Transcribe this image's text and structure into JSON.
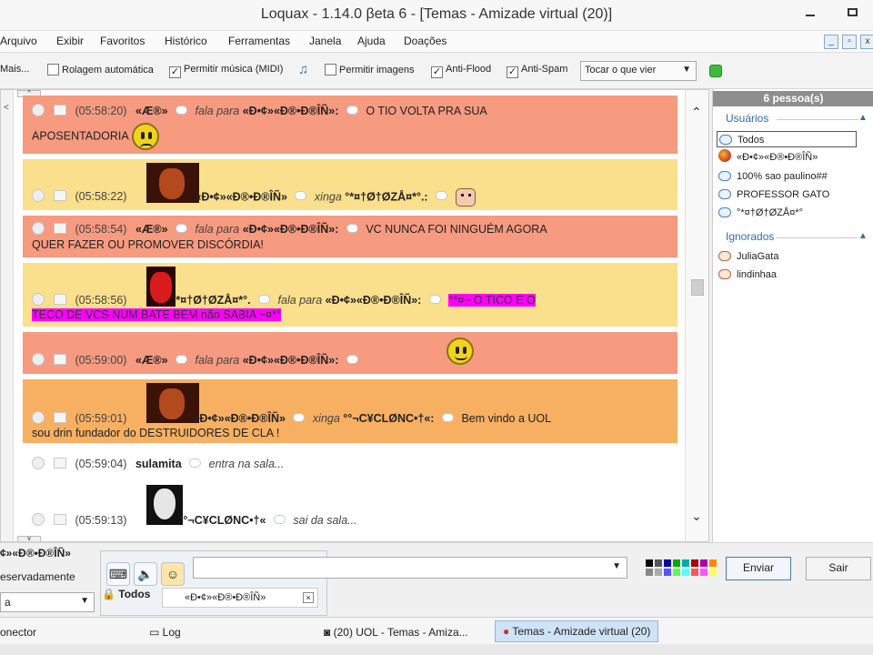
{
  "window": {
    "title": "Loquax - 1.14.0 βeta 6 - [Temas - Amizade virtual (20)]"
  },
  "menu": [
    "Arquivo",
    "Exibir",
    "Favoritos",
    "Histórico",
    "Ferramentas",
    "Janela",
    "Ajuda",
    "Doações"
  ],
  "toolbar": {
    "mais": "Mais...",
    "options": [
      {
        "label": "Rolagem automática",
        "checked": false
      },
      {
        "label": "Permitir música (MIDI)",
        "checked": true
      },
      {
        "label": "Permitir imagens",
        "checked": false
      },
      {
        "label": "Anti-Flood",
        "checked": true
      },
      {
        "label": "Anti-Spam",
        "checked": true
      }
    ],
    "sound_select": "Tocar o que vier",
    "status_color": "#3cbc3c"
  },
  "messages": [
    {
      "time": "(05:58:20)",
      "from": "«Æ®»",
      "action": "fala para",
      "to": "«Ð•¢»«Ð®•Ð®ÎÑ»:",
      "text1": "O TIO VOLTA PRA SUA",
      "text2": "APOSENTADORIA",
      "color": "#f69a80"
    },
    {
      "time": "(05:58:22)",
      "from": "«Ð•¢»«Ð®•Ð®ÎÑ»",
      "action": "xinga",
      "to": "°*¤†Ø†ØZÅ¤*°.:",
      "color": "#fadf8c"
    },
    {
      "time": "(05:58:54)",
      "from": "«Æ®»",
      "action": "fala para",
      "to": "«Ð•¢»«Ð®•Ð®ÎÑ»:",
      "text1": "VC NUNCA FOI NINGUÉM AGORA",
      "text2": "QUER FAZER OU PROMOVER DISCÓRDIA!",
      "color": "#f69a80"
    },
    {
      "time": "(05:58:56)",
      "from": "°*¤†Ø†ØZÅ¤*°.",
      "action": "fala para",
      "to": "«Ð•¢»«Ð®•Ð®ÎÑ»:",
      "text1": "°*¤~ O TICO E O",
      "text2": "TECO DE VCS NUM BATE BEM não SABIA ~¤*°",
      "color": "#fadf8c"
    },
    {
      "time": "(05:59:00)",
      "from": "«Æ®»",
      "action": "fala para",
      "to": "«Ð•¢»«Ð®•Ð®ÎÑ»:",
      "color": "#f69a80"
    },
    {
      "time": "(05:59:01)",
      "from": "«Ð•¢»«Ð®•Ð®ÎÑ»",
      "action": "xinga",
      "to": "°°¬C¥CLØNC•†«:",
      "text1": "Bem vindo a UOL",
      "text2": "sou drin fundador do DESTRUIDORES DE CLA !",
      "color": "#f7b062"
    },
    {
      "time": "(05:59:04)",
      "from": "sulamita",
      "action": "entra na sala...",
      "color": "#ffffff"
    },
    {
      "time": "(05:59:13)",
      "from": "°°¬C¥CLØNC•†«",
      "action": "sai da sala...",
      "color": "#ffffff"
    }
  ],
  "users_panel": {
    "header": "6 pessoa(s)",
    "group_users": "Usuários",
    "users": [
      "Todos",
      "«Ð•¢»«Ð®•Ð®ÎÑ»",
      "100% sao paulino##",
      "PROFESSOR GATO",
      "°*¤†Ø†ØZÅ¤*°"
    ],
    "group_ignored": "Ignorados",
    "ignored": [
      "JuliaGata",
      "lindinhaa"
    ]
  },
  "compose": {
    "nick": "¢»«Ð®•Ð®ÎÑ»",
    "reserv": "eservadamente",
    "left_combo": "a",
    "todos": "Todos",
    "recipient": "«Ð•¢»«Ð®•Ð®ÎÑ»",
    "send": "Enviar",
    "sair": "Sair"
  },
  "palette_colors": [
    "#000000",
    "#555555",
    "#0000aa",
    "#00aa00",
    "#00aaaa",
    "#aa0000",
    "#aa00aa",
    "#ff8800",
    "#888888",
    "#aaaaaa",
    "#5555ff",
    "#55ff55",
    "#55ffff",
    "#ff5555",
    "#ff55ff",
    "#ffff55"
  ],
  "statusbar": {
    "connector": "onector",
    "log": "Log",
    "task1": "(20)  UOL - Temas - Amiza...",
    "task2": "Temas - Amizade virtual (20)"
  }
}
